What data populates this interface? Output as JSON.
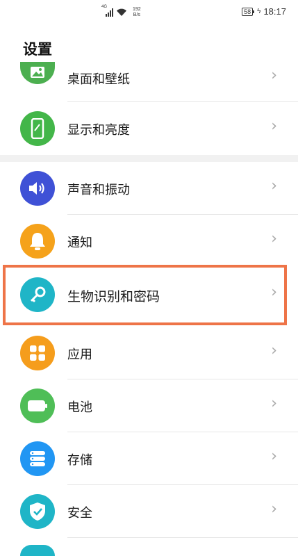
{
  "status_bar": {
    "network": "4G",
    "speed_value": "192",
    "speed_unit": "B/s",
    "battery": "58",
    "time": "18:17"
  },
  "page_title": "设置",
  "items": [
    {
      "label": "桌面和壁纸",
      "icon": "wallpaper-icon",
      "color": "#4caf50"
    },
    {
      "label": "显示和亮度",
      "icon": "display-icon",
      "color": "#43b649"
    },
    {
      "label": "声音和振动",
      "icon": "speaker-icon",
      "color": "#3f51d6"
    },
    {
      "label": "通知",
      "icon": "bell-icon",
      "color": "#f5a21b"
    },
    {
      "label": "生物识别和密码",
      "icon": "key-icon",
      "color": "#1fb5c7"
    },
    {
      "label": "应用",
      "icon": "apps-icon",
      "color": "#f59d1c"
    },
    {
      "label": "电池",
      "icon": "battery-icon",
      "color": "#4fbe57"
    },
    {
      "label": "存储",
      "icon": "storage-icon",
      "color": "#2196f3"
    },
    {
      "label": "安全",
      "icon": "shield-icon",
      "color": "#1fb5c7"
    }
  ],
  "highlight_color": "#ee7448"
}
